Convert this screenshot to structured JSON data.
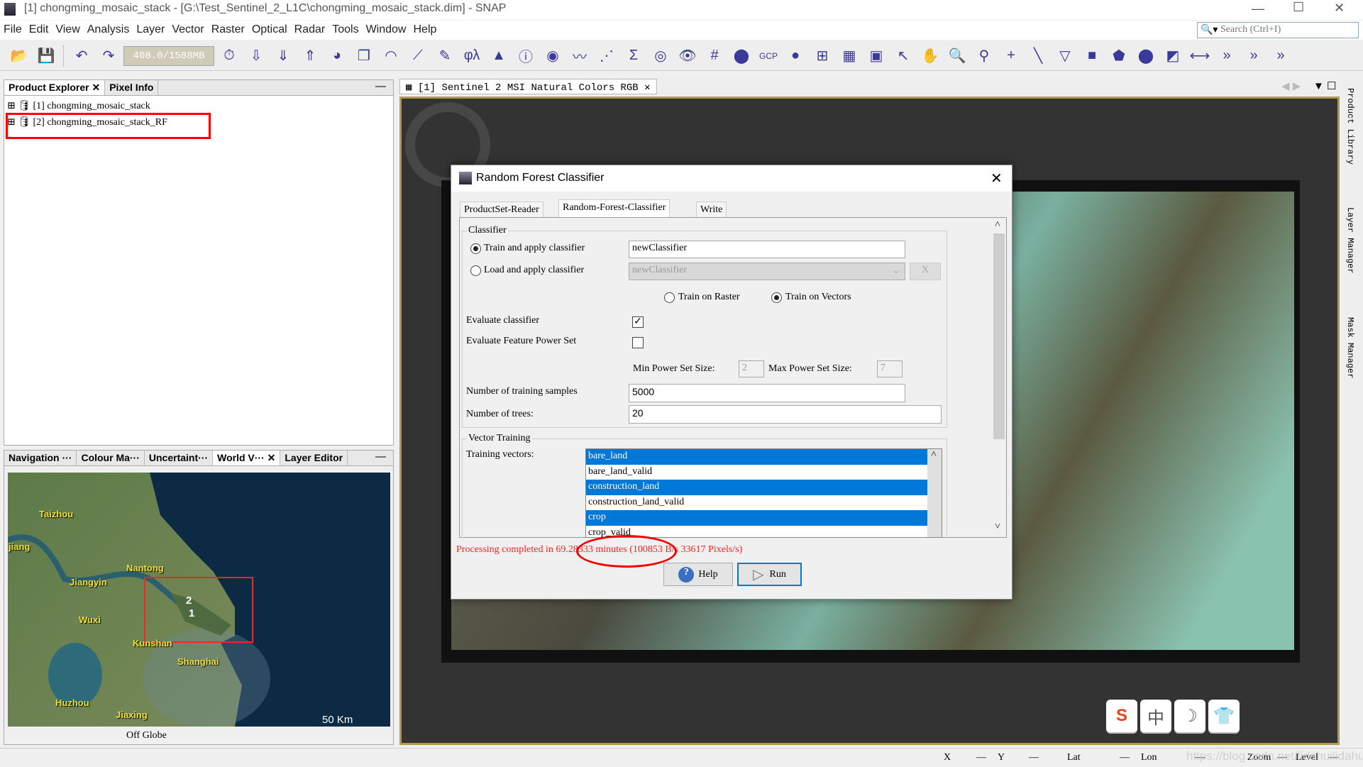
{
  "window": {
    "title": "[1] chongming_mosaic_stack - [G:\\Test_Sentinel_2_L1C\\chongming_mosaic_stack.dim] - SNAP",
    "controls": [
      "—",
      "☐",
      "✕"
    ]
  },
  "menu": [
    "File",
    "Edit",
    "View",
    "Analysis",
    "Layer",
    "Vector",
    "Raster",
    "Optical",
    "Radar",
    "Tools",
    "Window",
    "Help"
  ],
  "search": {
    "placeholder": "Search (Ctrl+I)"
  },
  "toolbar": {
    "memory": "408.0/1588MB",
    "icons_left": [
      {
        "name": "open-product",
        "g": "📂"
      },
      {
        "name": "save-product",
        "g": "💾"
      },
      {
        "name": "undo",
        "g": "↶"
      },
      {
        "name": "redo",
        "g": "↷"
      }
    ],
    "icons": [
      {
        "name": "session",
        "g": "⏱"
      },
      {
        "name": "import",
        "g": "⇩"
      },
      {
        "name": "export-green",
        "g": "⇓"
      },
      {
        "name": "export",
        "g": "⇑"
      },
      {
        "name": "rgb-image",
        "g": "◕"
      },
      {
        "name": "new-window",
        "g": "❐"
      },
      {
        "name": "wave",
        "g": "◠"
      },
      {
        "name": "spectrum",
        "g": "⟋"
      },
      {
        "name": "pencil",
        "g": "✎"
      },
      {
        "name": "phi-lambda",
        "g": "φλ"
      },
      {
        "name": "histogram",
        "g": "▲"
      },
      {
        "name": "information",
        "g": "ⓘ"
      },
      {
        "name": "band-maths",
        "g": "◉"
      },
      {
        "name": "profile",
        "g": "〰"
      },
      {
        "name": "scatter",
        "g": "⋰"
      },
      {
        "name": "sigma",
        "g": "Σ"
      },
      {
        "name": "layers",
        "g": "◎"
      },
      {
        "name": "eye",
        "g": "👁"
      },
      {
        "name": "grid",
        "g": "#"
      },
      {
        "name": "pin",
        "g": "⬤"
      },
      {
        "name": "gcp",
        "g": "GCP"
      },
      {
        "name": "globe",
        "g": "●"
      },
      {
        "name": "graph-builder",
        "g": "⊞"
      },
      {
        "name": "batch",
        "g": "▦"
      },
      {
        "name": "world-map",
        "g": "▣"
      },
      {
        "name": "select-tool",
        "g": "↖"
      },
      {
        "name": "pan-tool",
        "g": "✋"
      },
      {
        "name": "zoom-tool",
        "g": "🔍"
      },
      {
        "name": "pin-placing",
        "g": "⚲"
      },
      {
        "name": "gcp-placing",
        "g": "+"
      },
      {
        "name": "line-drawing",
        "g": "╲"
      },
      {
        "name": "polyline",
        "g": "▽"
      },
      {
        "name": "rectangle",
        "g": "■"
      },
      {
        "name": "polygon",
        "g": "⬟"
      },
      {
        "name": "ellipse",
        "g": "⬤"
      },
      {
        "name": "insert-figure",
        "g": "◩"
      },
      {
        "name": "range-finder",
        "g": "⟷"
      },
      {
        "name": "more",
        "g": "»"
      },
      {
        "name": "more-2",
        "g": "»"
      },
      {
        "name": "more-3",
        "g": "»"
      }
    ]
  },
  "product_explorer": {
    "tabs": [
      "Product Explorer",
      "Pixel Info"
    ],
    "items": [
      {
        "index": "[1]",
        "name": "chongming_mosaic_stack"
      },
      {
        "index": "[2]",
        "name": "chongming_mosaic_stack_RF"
      }
    ]
  },
  "bottom_panel": {
    "tabs": [
      "Navigation ···",
      "Colour Ma···",
      "Uncertaint···",
      "World V···",
      "Layer Editor"
    ],
    "map_labels": [
      "Taizhou",
      "jiang",
      "Nantong",
      "Jiangyin",
      "Wuxi",
      "Kunshan",
      "Shanghai",
      "Huzhou",
      "Jiaxing"
    ],
    "product_marks": [
      "2",
      "1"
    ],
    "scale": "50 Km",
    "status": "Off Globe"
  },
  "image_view": {
    "tab": "[1] Sentinel 2 MSI Natural Colors RGB"
  },
  "right_sidebar": [
    "Product Library",
    "Layer Manager",
    "Mask Manager"
  ],
  "dialog": {
    "title": "Random Forest Classifier",
    "tabs": [
      "ProductSet-Reader",
      "Random-Forest-Classifier",
      "Write"
    ],
    "active_tab": "Random-Forest-Classifier",
    "classifier_group": "Classifier",
    "train_apply": "Train and apply classifier",
    "train_apply_value": "newClassifier",
    "load_apply": "Load and apply classifier",
    "load_value": "newClassifier",
    "clear_button": "X",
    "train_raster": "Train on Raster",
    "train_vectors": "Train on Vectors",
    "selected_training": "Train on Vectors",
    "evaluate": "Evaluate classifier",
    "evaluate_checked": true,
    "evaluate_fps": "Evaluate Feature Power Set",
    "evaluate_fps_checked": false,
    "min_label": "Min Power Set Size:",
    "min_value": "2",
    "max_label": "Max Power Set Size:",
    "max_value": "7",
    "samples_label": "Number of training samples",
    "samples_value": "5000",
    "trees_label": "Number of trees:",
    "trees_value": "20",
    "vector_group": "Vector Training",
    "vectors_label": "Training vectors:",
    "vectors": [
      {
        "name": "bare_land",
        "selected": true
      },
      {
        "name": "bare_land_valid",
        "selected": false
      },
      {
        "name": "construction_land",
        "selected": true
      },
      {
        "name": "construction_land_valid",
        "selected": false
      },
      {
        "name": "crop",
        "selected": true
      },
      {
        "name": "crop_valid",
        "selected": false
      }
    ],
    "status": {
      "prefix": "Processing completed in ",
      "time": "69.28333 minutes",
      "suffix": " (100853 B/s 33617 Pixels/s)",
      "color": "#ff2020"
    },
    "help": "Help",
    "run": "Run"
  },
  "statusbar": {
    "x": "X",
    "y": "Y",
    "lat": "Lat",
    "lon": "Lon",
    "zoom": "Zoom",
    "level": "Level",
    "dash": "—",
    "watermark": "https://blog.csdn.net/lidahuilidahui"
  },
  "colors": {
    "selection": "#0078d7",
    "highlight": "#ff0000",
    "frame": "#b49a50"
  }
}
